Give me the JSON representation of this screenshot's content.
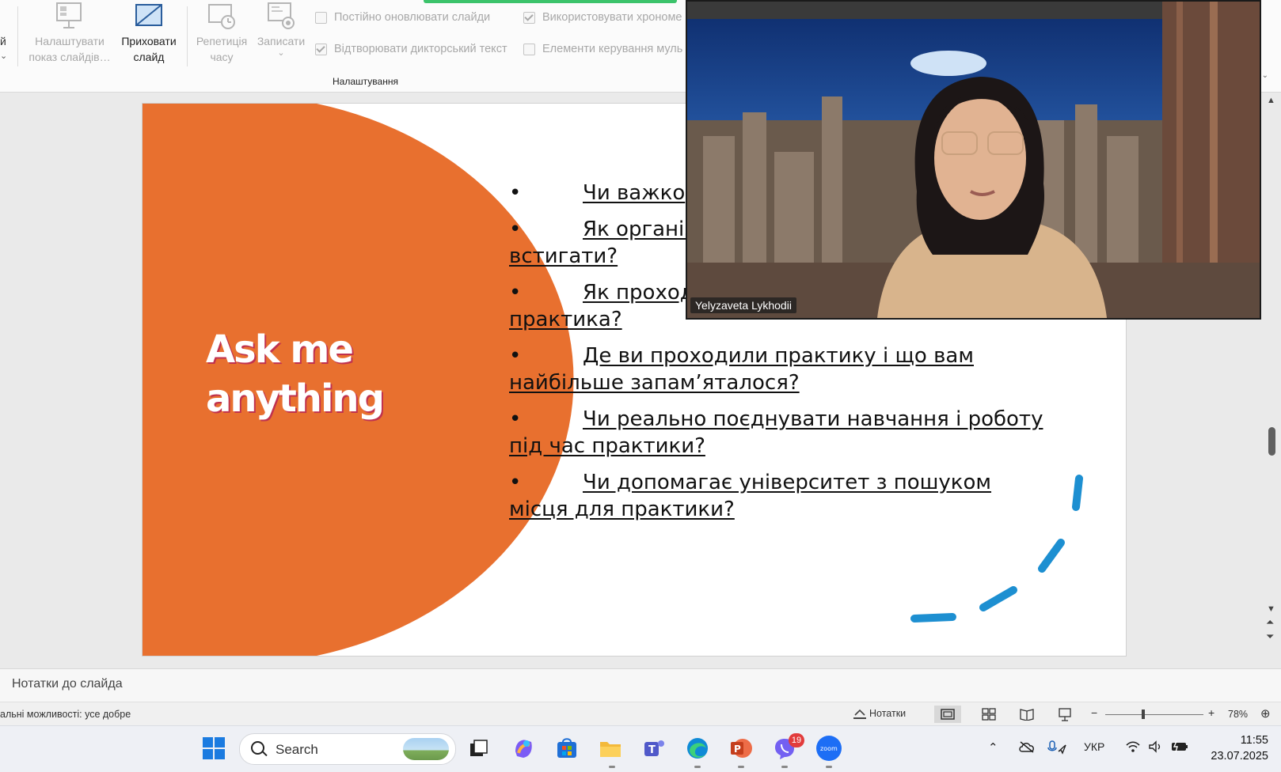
{
  "ribbon": {
    "cut_label": "й",
    "cut_chevron": "⌄",
    "btn_setup_show": "Налаштувати показ слайдів…",
    "btn_hide_slide": "Приховати слайд",
    "btn_rehearse": "Репетиція часу",
    "btn_record": "Записати",
    "btn_record_chevron": "⌄",
    "chk_keep_updated": "Постійно оновлювати слайди",
    "chk_play_narrations": "Відтворювати дикторський текст",
    "chk_use_timings": "Використовувати хрономе",
    "chk_media_controls": "Елементи керування муль",
    "group_label": "Налаштування",
    "accent": "#3cc36b"
  },
  "slide": {
    "title": "Ask me\nanything",
    "orange": "#e8702f",
    "bullets": [
      {
        "dot": "•",
        "text": "Чи важко"
      },
      {
        "dot": "•",
        "text": "Як організ\nвстигати?"
      },
      {
        "dot": "•",
        "text": "Як проход\nпрактика?"
      },
      {
        "dot": "•",
        "text": "Де ви проходили практику і що вам\nнайбільше запам’яталося?"
      },
      {
        "dot": "•",
        "text": "Чи реально поєднувати навчання і роботу\nпід час практики?"
      },
      {
        "dot": "•",
        "text": "Чи допомагає університет з пошуком\nмісця для практики?"
      }
    ],
    "ink_color": "#1d8fd1"
  },
  "video": {
    "participant_name": "Yelyzaveta Lykhodii"
  },
  "notes": {
    "label": "Нотатки до слайда"
  },
  "status": {
    "accessibility": "альні можливості: усе добре",
    "notes_button": "Нотатки",
    "zoom_minus": "−",
    "zoom_plus": "+",
    "zoom": "78%",
    "zoom_fraction": 0.5
  },
  "taskbar": {
    "search_placeholder": "Search",
    "language": "УКР",
    "time": "11:55",
    "date": "23.07.2025",
    "viber_badge": "19",
    "zoom_app_label": "zoom"
  },
  "scroll": {
    "up": "▲",
    "down": "▼",
    "prev": "⏶",
    "next": "⏷"
  }
}
